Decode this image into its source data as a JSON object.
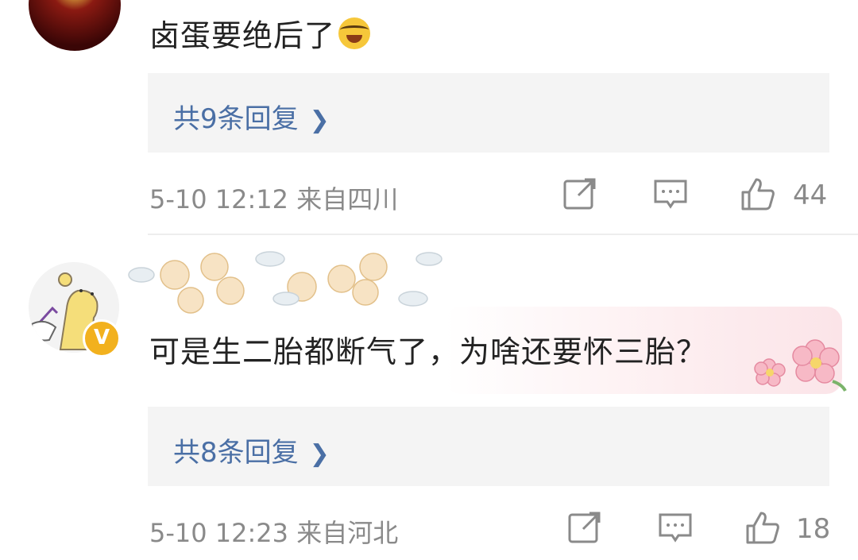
{
  "comments": [
    {
      "text": "卤蛋要绝后了",
      "emoji": "crying-laughing-emoji",
      "replies_label": "共9条回复",
      "timestamp": "5-10 12:12",
      "location": "来自四川",
      "likes": "44"
    },
    {
      "text": "可是生二胎都断气了，为啥还要怀三胎？",
      "replies_label": "共8条回复",
      "timestamp": "5-10 12:23",
      "location": "来自河北",
      "likes": "18",
      "verified_badge": "V"
    }
  ],
  "colors": {
    "link": "#4a6fa5",
    "meta": "#8a8a8a",
    "reply_bg": "#f4f4f4",
    "badge": "#f2b11e"
  },
  "icons": [
    "share-icon",
    "comment-icon",
    "like-icon",
    "chevron-right-icon"
  ]
}
